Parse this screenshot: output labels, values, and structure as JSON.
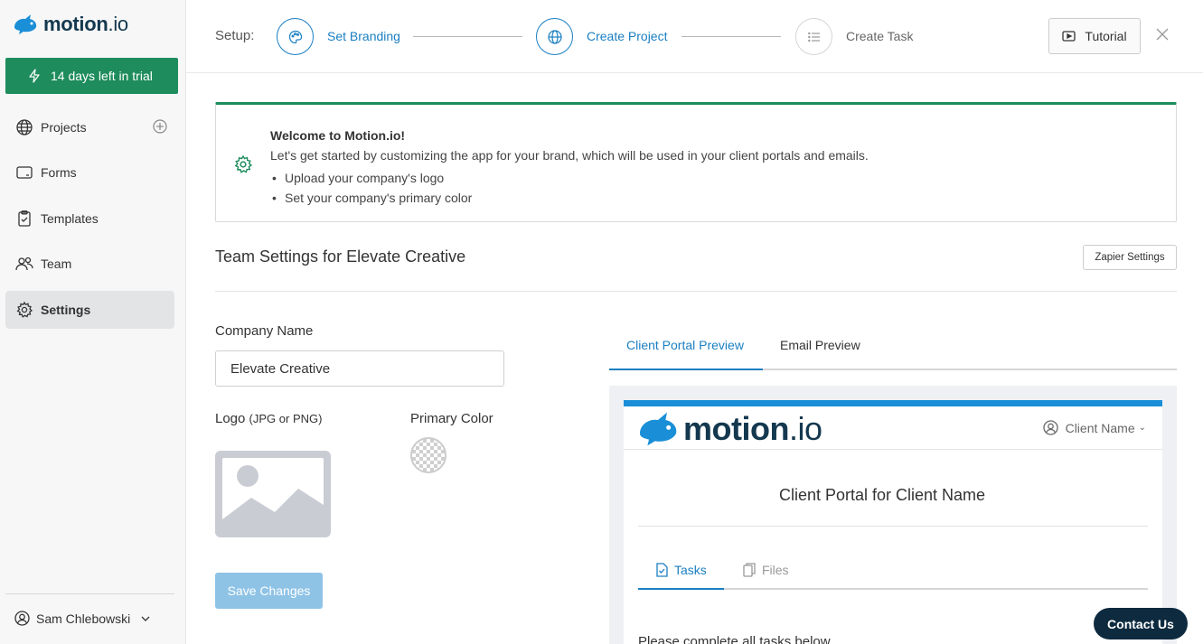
{
  "brand": {
    "name_bold": "motion",
    "name_suffix": ".io",
    "color": "#14384f"
  },
  "sidebar": {
    "trial_text": "14 days left in trial",
    "items": [
      {
        "label": "Projects",
        "icon": "globe-icon"
      },
      {
        "label": "Forms",
        "icon": "form-icon"
      },
      {
        "label": "Templates",
        "icon": "clipboard-icon"
      },
      {
        "label": "Team",
        "icon": "team-icon"
      },
      {
        "label": "Settings",
        "icon": "gear-icon",
        "active": true
      }
    ],
    "user_name": "Sam Chlebowski"
  },
  "topbar": {
    "setup_label": "Setup:",
    "steps": [
      {
        "label": "Set Branding",
        "icon": "palette-icon",
        "state": "active"
      },
      {
        "label": "Create Project",
        "icon": "globe-icon",
        "state": "active"
      },
      {
        "label": "Create Task",
        "icon": "list-icon",
        "state": "inactive"
      }
    ],
    "tutorial_label": "Tutorial"
  },
  "welcome": {
    "title": "Welcome to Motion.io!",
    "text": "Let's get started by customizing the app for your brand, which will be used in your client portals and emails.",
    "bullets": [
      "Upload your company's logo",
      "Set your company's primary color"
    ]
  },
  "settings": {
    "title": "Team Settings for Elevate Creative",
    "zapier_label": "Zapier Settings",
    "company_name_label": "Company Name",
    "company_name_value": "Elevate Creative",
    "logo_label": "Logo",
    "logo_hint": "(JPG or PNG)",
    "primary_color_label": "Primary Color",
    "save_label": "Save Changes"
  },
  "preview": {
    "tabs": [
      {
        "label": "Client Portal Preview",
        "active": true
      },
      {
        "label": "Email Preview",
        "active": false
      }
    ],
    "client_name": "Client Name",
    "portal_title": "Client Portal for Client Name",
    "inner_tabs": [
      {
        "label": "Tasks",
        "icon": "task-icon",
        "active": true
      },
      {
        "label": "Files",
        "icon": "files-icon",
        "active": false
      }
    ],
    "tasks_text": "Please complete all tasks below",
    "accent_color": "#1a8fd8"
  },
  "contact_label": "Contact Us",
  "colors": {
    "primary": "#1a7fc2",
    "trial_green": "#1e8c5c",
    "save_disabled": "#8fc3e6"
  }
}
